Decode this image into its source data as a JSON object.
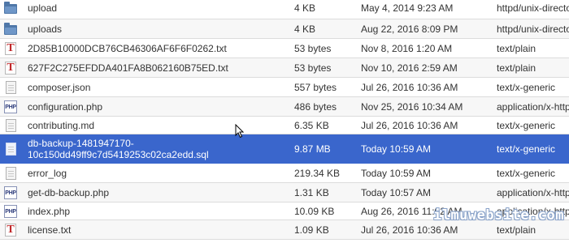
{
  "files": [
    {
      "name_line1": "upload",
      "size": "4 KB",
      "modified": "May 4, 2014 9:23 AM",
      "type": "httpd/unix-directory",
      "icon": "folder-icon"
    },
    {
      "name_line1": "uploads",
      "size": "4 KB",
      "modified": "Aug 22, 2016 8:09 PM",
      "type": "httpd/unix-directory",
      "icon": "folder-icon"
    },
    {
      "name_line1": "2D85B10000DCB76CB46306AF6F6F0262.txt",
      "size": "53 bytes",
      "modified": "Nov 8, 2016 1:20 AM",
      "type": "text/plain",
      "icon": "text-file-icon"
    },
    {
      "name_line1": "627F2C275EFDDA401FA8B062160B75ED.txt",
      "size": "53 bytes",
      "modified": "Nov 10, 2016 2:59 AM",
      "type": "text/plain",
      "icon": "text-file-icon"
    },
    {
      "name_line1": "composer.json",
      "size": "557 bytes",
      "modified": "Jul 26, 2016 10:36 AM",
      "type": "text/x-generic",
      "icon": "generic-file-icon"
    },
    {
      "name_line1": "configuration.php",
      "size": "486 bytes",
      "modified": "Nov 25, 2016 10:34 AM",
      "type": "application/x-httpd-php",
      "icon": "php-file-icon"
    },
    {
      "name_line1": "contributing.md",
      "size": "6.35 KB",
      "modified": "Jul 26, 2016 10:36 AM",
      "type": "text/x-generic",
      "icon": "generic-file-icon"
    },
    {
      "name_line1": "db-backup-1481947170-",
      "name_line2": "10c150dd49ff9c7d5419253c02ca2edd.sql",
      "size": "9.87 MB",
      "modified": "Today 10:59 AM",
      "type": "text/x-generic",
      "icon": "generic-file-icon"
    },
    {
      "name_line1": "error_log",
      "size": "219.34 KB",
      "modified": "Today 10:59 AM",
      "type": "text/x-generic",
      "icon": "generic-file-icon"
    },
    {
      "name_line1": "get-db-backup.php",
      "size": "1.31 KB",
      "modified": "Today 10:57 AM",
      "type": "application/x-httpd-php",
      "icon": "php-file-icon"
    },
    {
      "name_line1": "index.php",
      "size": "10.09 KB",
      "modified": "Aug 26, 2016 11:02 AM",
      "type": "application/x-httpd-php",
      "icon": "php-file-icon"
    },
    {
      "name_line1": "license.txt",
      "size": "1.09 KB",
      "modified": "Jul 26, 2016 10:36 AM",
      "type": "text/plain",
      "icon": "text-file-icon"
    }
  ],
  "php_icon_text": "PHP",
  "text_icon_text": "T",
  "watermark": "ilmuwebsite.com",
  "colors": {
    "selected_row": "#3a66cc",
    "folder": "#4f77a8",
    "text_icon": "#c0282a"
  }
}
